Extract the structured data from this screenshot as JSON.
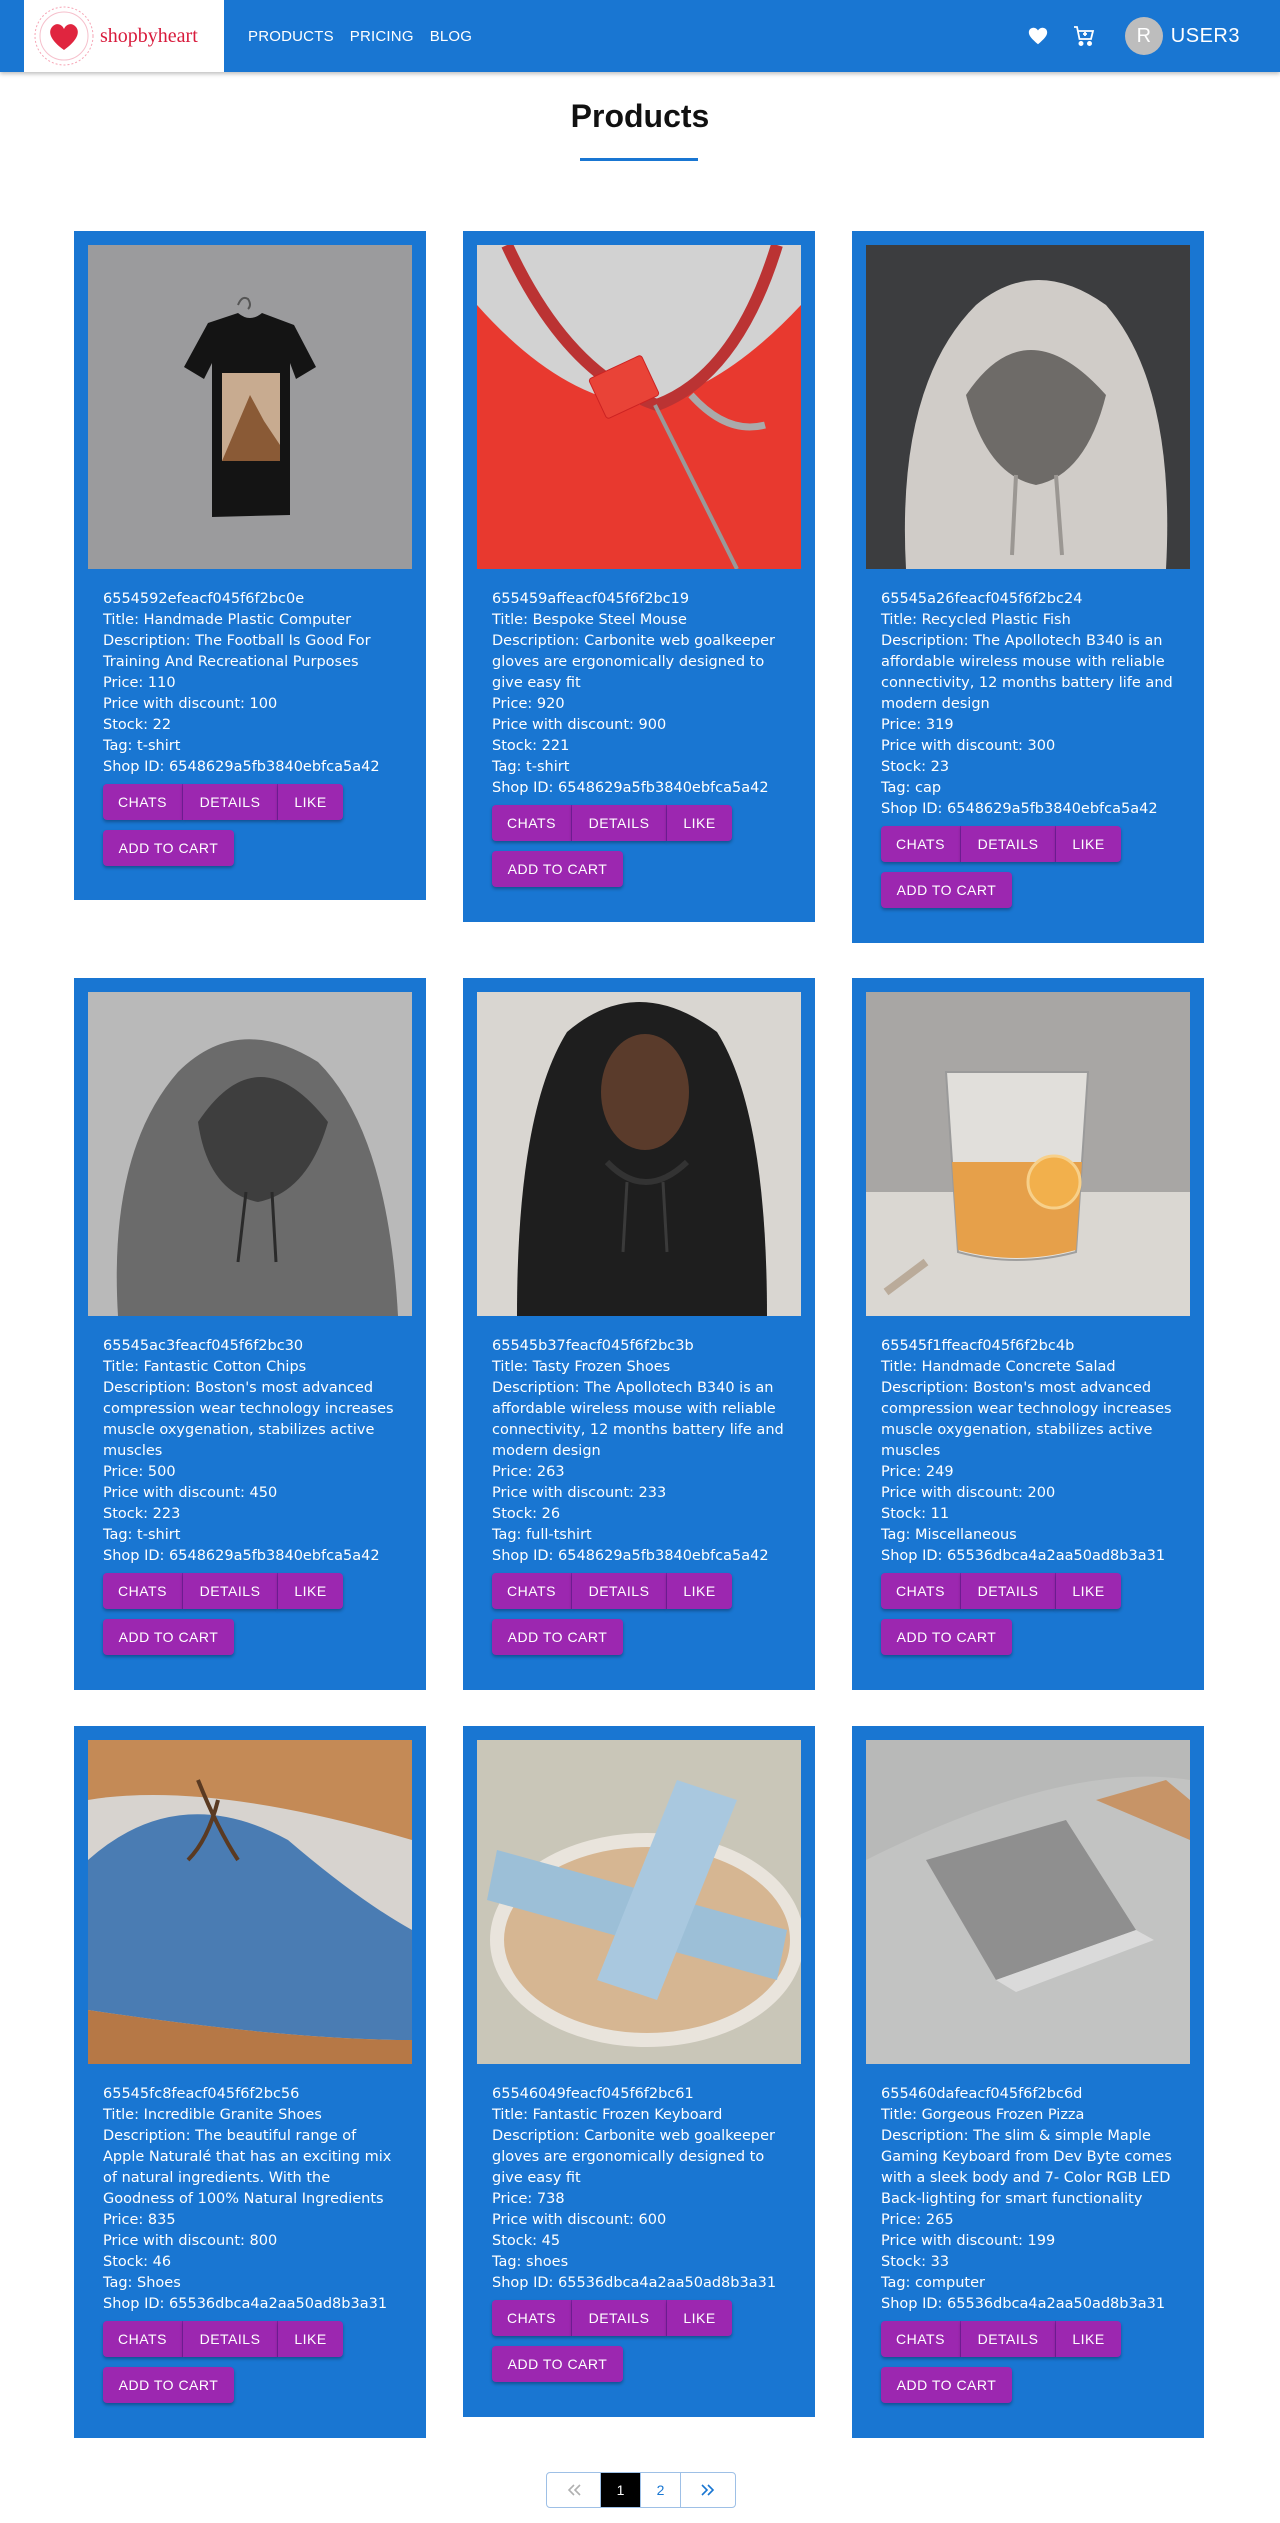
{
  "nav": {
    "brand": "shopbyheart",
    "links": [
      "PRODUCTS",
      "PRICING",
      "BLOG"
    ],
    "avatar_letter": "R",
    "user": "USER3"
  },
  "page_title": "Products",
  "buttons": {
    "chats": "CHATS",
    "details": "DETAILS",
    "like": "LIKE",
    "add_to_cart": "ADD TO CART"
  },
  "products": [
    {
      "id": "6554592efeacf045f6f2bc0e",
      "title": "Title: Handmade Plastic Computer",
      "description": "Description: The Football Is Good For Training And Recreational Purposes",
      "price": "Price: 110",
      "price_discount": "Price with discount: 100",
      "stock": "Stock: 22",
      "tag": "Tag: t-shirt",
      "shop_id": "Shop ID: 6548629a5fb3840ebfca5a42",
      "image": "tshirt"
    },
    {
      "id": "655459affeacf045f6f2bc19",
      "title": "Title: Bespoke Steel Mouse",
      "description": "Description: Carbonite web goalkeeper gloves are ergonomically designed to give easy fit",
      "price": "Price: 920",
      "price_discount": "Price with discount: 900",
      "stock": "Stock: 221",
      "tag": "Tag: t-shirt",
      "shop_id": "Shop ID: 6548629a5fb3840ebfca5a42",
      "image": "red-hoodie"
    },
    {
      "id": "65545a26feacf045f6f2bc24",
      "title": "Title: Recycled Plastic Fish",
      "description": "Description: The Apollotech B340 is an affordable wireless mouse with reliable connectivity, 12 months battery life and modern design",
      "price": "Price: 319",
      "price_discount": "Price with discount: 300",
      "stock": "Stock: 23",
      "tag": "Tag: cap",
      "shop_id": "Shop ID: 6548629a5fb3840ebfca5a42",
      "image": "grey-hoodie"
    },
    {
      "id": "65545ac3feacf045f6f2bc30",
      "title": "Title: Fantastic Cotton Chips",
      "description": "Description: Boston's most advanced compression wear technology increases muscle oxygenation, stabilizes active muscles",
      "price": "Price: 500",
      "price_discount": "Price with discount: 450",
      "stock": "Stock: 223",
      "tag": "Tag: t-shirt",
      "shop_id": "Shop ID: 6548629a5fb3840ebfca5a42",
      "image": "dark-hoodie"
    },
    {
      "id": "65545b37feacf045f6f2bc3b",
      "title": "Title: Tasty Frozen Shoes",
      "description": "Description: The Apollotech B340 is an affordable wireless mouse with reliable connectivity, 12 months battery life and modern design",
      "price": "Price: 263",
      "price_discount": "Price with discount: 233",
      "stock": "Stock: 26",
      "tag": "Tag: full-tshirt",
      "shop_id": "Shop ID: 6548629a5fb3840ebfca5a42",
      "image": "woman-hoodie"
    },
    {
      "id": "65545f1ffeacf045f6f2bc4b",
      "title": "Title: Handmade Concrete Salad",
      "description": "Description: Boston's most advanced compression wear technology increases muscle oxygenation, stabilizes active muscles",
      "price": "Price: 249",
      "price_discount": "Price with discount: 200",
      "stock": "Stock: 11",
      "tag": "Tag: Miscellaneous",
      "shop_id": "Shop ID: 65536dbca4a2aa50ad8b3a31",
      "image": "glass"
    },
    {
      "id": "65545fc8feacf045f6f2bc56",
      "title": "Title: Incredible Granite Shoes",
      "description": "Description: The beautiful range of Apple Naturalé that has an exciting mix of natural ingredients. With the Goodness of 100% Natural Ingredients",
      "price": "Price: 835",
      "price_discount": "Price with discount: 800",
      "stock": "Stock: 46",
      "tag": "Tag: Shoes",
      "shop_id": "Shop ID: 65536dbca4a2aa50ad8b3a31",
      "image": "blue-shoe"
    },
    {
      "id": "65546049feacf045f6f2bc61",
      "title": "Title: Fantastic Frozen Keyboard",
      "description": "Description: Carbonite web goalkeeper gloves are ergonomically designed to give easy fit",
      "price": "Price: 738",
      "price_discount": "Price with discount: 600",
      "stock": "Stock: 45",
      "tag": "Tag: shoes",
      "shop_id": "Shop ID: 65536dbca4a2aa50ad8b3a31",
      "image": "sandal"
    },
    {
      "id": "655460dafeacf045f6f2bc6d",
      "title": "Title: Gorgeous Frozen Pizza",
      "description": "Description: The slim & simple Maple Gaming Keyboard from Dev Byte comes with a sleek body and 7- Color RGB LED Back-lighting for smart functionality",
      "price": "Price: 265",
      "price_discount": "Price with discount: 199",
      "stock": "Stock: 33",
      "tag": "Tag: computer",
      "shop_id": "Shop ID: 65536dbca4a2aa50ad8b3a31",
      "image": "laptop"
    }
  ],
  "pagination": {
    "current": "1",
    "next_page": "2"
  }
}
